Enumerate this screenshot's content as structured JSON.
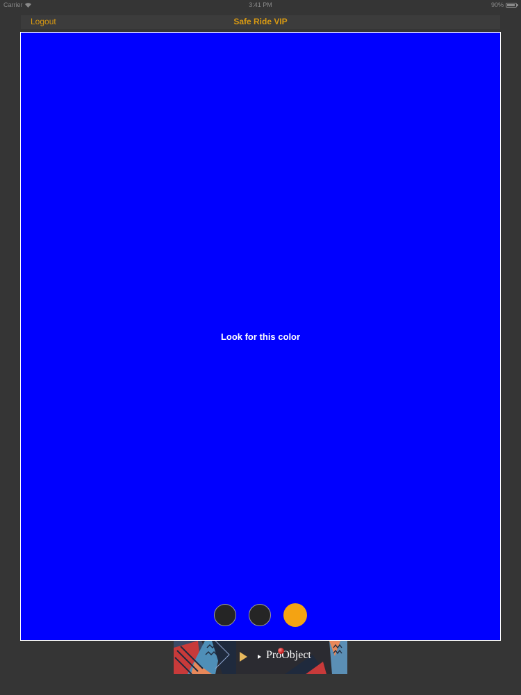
{
  "status_bar": {
    "carrier": "Carrier",
    "time": "3:41 PM",
    "battery": "90%",
    "battery_level": 0.9,
    "wifi_icon": "wifi-icon",
    "battery_icon": "battery-icon"
  },
  "nav": {
    "logout_label": "Logout",
    "title": "Safe Ride VIP"
  },
  "panel": {
    "color": "#0000ff",
    "prompt": "Look for this color"
  },
  "page_indicator": {
    "count": 3,
    "active_index": 2,
    "active_color": "#f4a312",
    "inactive_color": "#252525"
  },
  "ad": {
    "brand": "ProObject",
    "play_icon": "play-icon"
  },
  "colors": {
    "background": "#353535",
    "accent": "#d99a12"
  }
}
